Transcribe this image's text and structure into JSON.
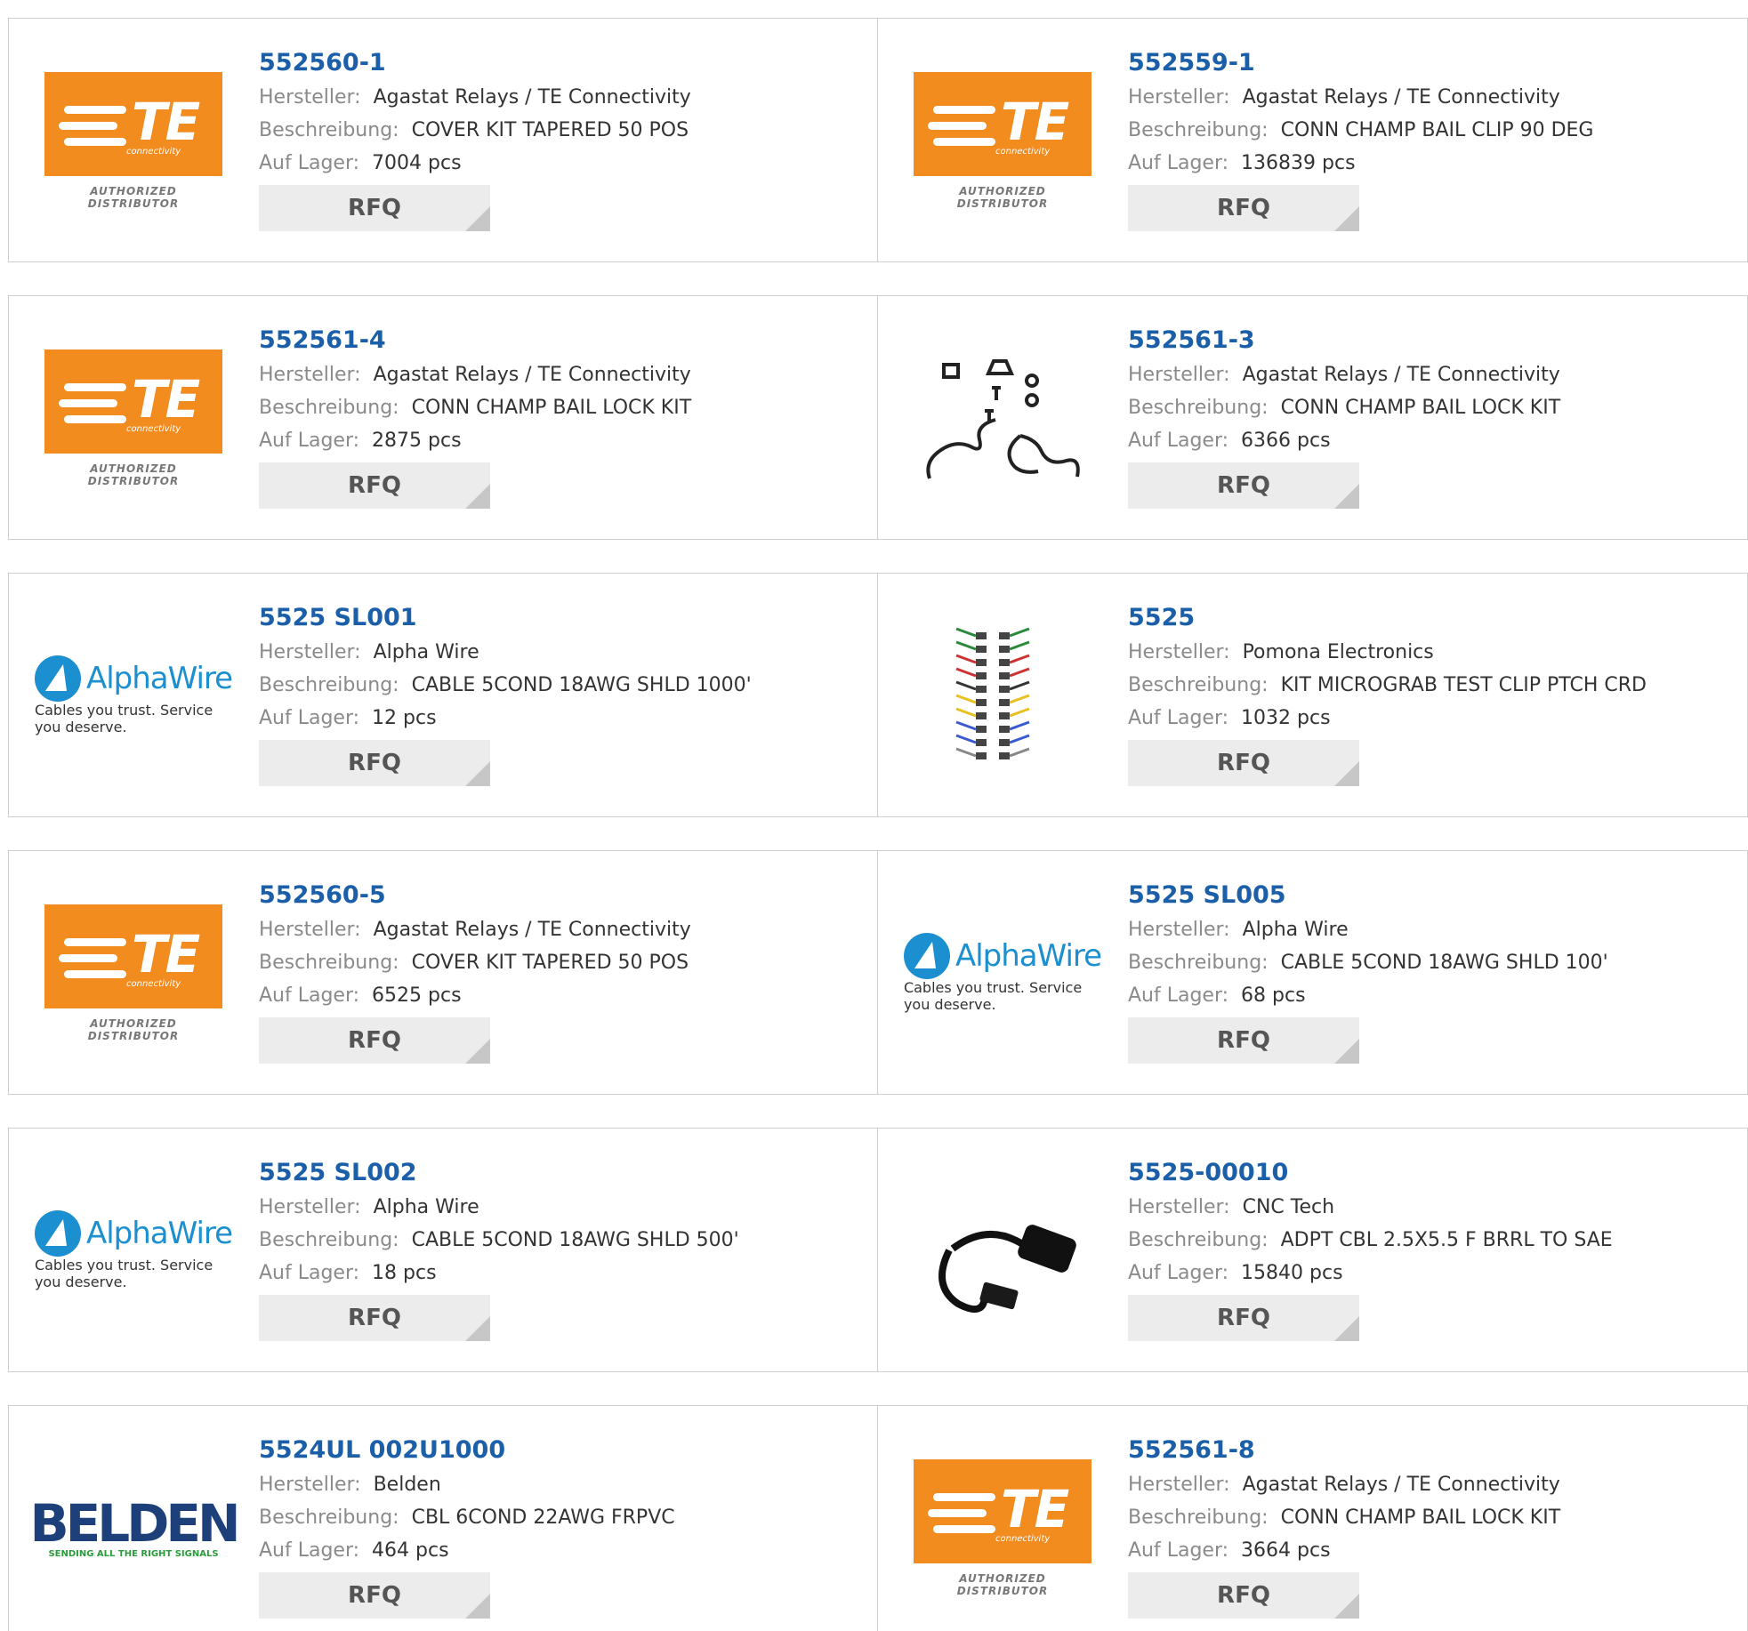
{
  "labels": {
    "manufacturer": "Hersteller:",
    "description": "Beschreibung:",
    "stock": "Auf Lager:",
    "rfq": "RFQ"
  },
  "products": [
    {
      "part": "552560-1",
      "manufacturer": "Agastat Relays / TE Connectivity",
      "description": "COVER KIT TAPERED 50 POS",
      "stock": "7004 pcs",
      "logo": "te-logo"
    },
    {
      "part": "552559-1",
      "manufacturer": "Agastat Relays / TE Connectivity",
      "description": "CONN CHAMP BAIL CLIP 90 DEG",
      "stock": "136839 pcs",
      "logo": "te-logo"
    },
    {
      "part": "552561-4",
      "manufacturer": "Agastat Relays / TE Connectivity",
      "description": "CONN CHAMP BAIL LOCK KIT",
      "stock": "2875 pcs",
      "logo": "te-logo"
    },
    {
      "part": "552561-3",
      "manufacturer": "Agastat Relays / TE Connectivity",
      "description": "CONN CHAMP BAIL LOCK KIT",
      "stock": "6366 pcs",
      "logo": "bail-lock-kit-photo"
    },
    {
      "part": "5525 SL001",
      "manufacturer": "Alpha Wire",
      "description": "CABLE 5COND 18AWG SHLD 1000'",
      "stock": "12 pcs",
      "logo": "alphawire-logo"
    },
    {
      "part": "5525",
      "manufacturer": "Pomona Electronics",
      "description": "KIT MICROGRAB TEST CLIP PTCH CRD",
      "stock": "1032 pcs",
      "logo": "test-clip-photo"
    },
    {
      "part": "552560-5",
      "manufacturer": "Agastat Relays / TE Connectivity",
      "description": "COVER KIT TAPERED 50 POS",
      "stock": "6525 pcs",
      "logo": "te-logo"
    },
    {
      "part": "5525 SL005",
      "manufacturer": "Alpha Wire",
      "description": "CABLE 5COND 18AWG SHLD 100'",
      "stock": "68 pcs",
      "logo": "alphawire-logo"
    },
    {
      "part": "5525 SL002",
      "manufacturer": "Alpha Wire",
      "description": "CABLE 5COND 18AWG SHLD 500'",
      "stock": "18 pcs",
      "logo": "alphawire-logo"
    },
    {
      "part": "5525-00010",
      "manufacturer": "CNC Tech",
      "description": "ADPT CBL 2.5X5.5 F BRRL TO SAE",
      "stock": "15840 pcs",
      "logo": "adapter-cable-photo"
    },
    {
      "part": "5524UL 002U1000",
      "manufacturer": "Belden",
      "description": "CBL 6COND 22AWG FRPVC",
      "stock": "464 pcs",
      "logo": "belden-logo"
    },
    {
      "part": "552561-8",
      "manufacturer": "Agastat Relays / TE Connectivity",
      "description": "CONN CHAMP BAIL LOCK KIT",
      "stock": "3664 pcs",
      "logo": "te-logo"
    }
  ],
  "logos": {
    "te": {
      "main": "TE",
      "sub": "connectivity",
      "authorized": "AUTHORIZED DISTRIBUTOR"
    },
    "alphawire": {
      "name": "AlphaWire",
      "tagline": "Cables you trust. Service you deserve."
    },
    "belden": {
      "name": "BELDEN",
      "tagline": "SENDING ALL THE RIGHT SIGNALS"
    }
  },
  "colors": {
    "part_link": "#1a5fa8",
    "te_orange": "#f28c1f",
    "alphawire_blue": "#1c8fd0",
    "belden_navy": "#1d3f7a",
    "belden_green": "#2a9d3b"
  }
}
